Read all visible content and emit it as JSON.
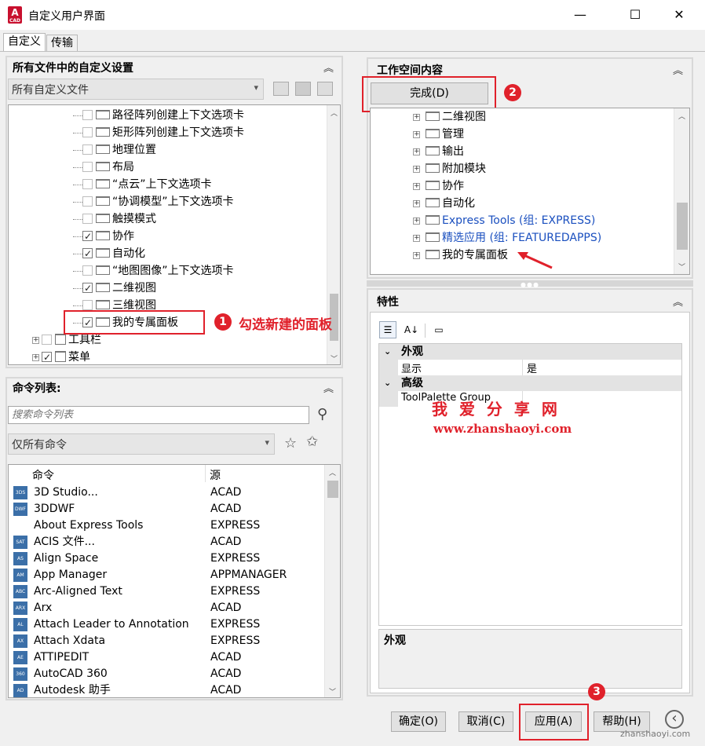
{
  "window": {
    "app_icon_letter": "A",
    "app_icon_sub": "CAD",
    "title": "自定义用户界面",
    "minimize": "—",
    "maximize": "☐",
    "close": "✕"
  },
  "tabs": [
    "自定义",
    "传输"
  ],
  "left_top": {
    "header": "所有文件中的自定义设置",
    "collapse": "︽",
    "file_select": "所有自定义文件",
    "tree": [
      {
        "label": "路径阵列创建上下文选项卡",
        "checked": false
      },
      {
        "label": "矩形阵列创建上下文选项卡",
        "checked": false
      },
      {
        "label": "地理位置",
        "checked": false
      },
      {
        "label": "布局",
        "checked": false
      },
      {
        "label": "“点云”上下文选项卡",
        "checked": false
      },
      {
        "label": "“协调模型”上下文选项卡",
        "checked": false
      },
      {
        "label": "触摸模式",
        "checked": false
      },
      {
        "label": "协作",
        "checked": true
      },
      {
        "label": "自动化",
        "checked": true
      },
      {
        "label": "“地图图像”上下文选项卡",
        "checked": false
      },
      {
        "label": "二维视图",
        "checked": true
      },
      {
        "label": "三维视图",
        "checked": false
      },
      {
        "label": "我的专属面板",
        "checked": true
      }
    ],
    "toolbars": "工具栏",
    "menus": "菜单"
  },
  "annotations": {
    "one": "1",
    "one_text": "勾选新建的面板",
    "two": "2",
    "three": "3",
    "watermark_cn": "我 爱 分 享 网",
    "watermark_url": "www.zhanshaoyi.com",
    "corner_url": "zhanshaoyi.com"
  },
  "cmd_list": {
    "header": "命令列表:",
    "collapse": "︽",
    "search_placeholder": "搜索命令列表",
    "filter": "仅所有命令",
    "col_command": "命令",
    "col_source": "源",
    "rows": [
      {
        "icon": "3DS",
        "name": "3D Studio...",
        "source": "ACAD"
      },
      {
        "icon": "DWF",
        "name": "3DDWF",
        "source": "ACAD"
      },
      {
        "icon": "",
        "name": "About Express Tools",
        "source": "EXPRESS"
      },
      {
        "icon": "SAT",
        "name": "ACIS 文件...",
        "source": "ACAD"
      },
      {
        "icon": "AS",
        "name": "Align Space",
        "source": "EXPRESS"
      },
      {
        "icon": "AM",
        "name": "App Manager",
        "source": "APPMANAGER"
      },
      {
        "icon": "ABC",
        "name": "Arc-Aligned Text",
        "source": "EXPRESS"
      },
      {
        "icon": "ARX",
        "name": "Arx",
        "source": "ACAD"
      },
      {
        "icon": "AL",
        "name": "Attach Leader to Annotation",
        "source": "EXPRESS"
      },
      {
        "icon": "AX",
        "name": "Attach Xdata",
        "source": "EXPRESS"
      },
      {
        "icon": "AE",
        "name": "ATTIPEDIT",
        "source": "ACAD"
      },
      {
        "icon": "360",
        "name": "AutoCAD 360",
        "source": "ACAD"
      },
      {
        "icon": "AD",
        "name": "Autodesk 助手",
        "source": "ACAD"
      }
    ]
  },
  "workspace": {
    "header": "工作空间内容",
    "collapse": "︽",
    "done_button": "完成(D)",
    "tree": [
      {
        "label": "二维视图",
        "blue": false
      },
      {
        "label": "管理",
        "blue": false
      },
      {
        "label": "输出",
        "blue": false
      },
      {
        "label": "附加模块",
        "blue": false
      },
      {
        "label": "协作",
        "blue": false
      },
      {
        "label": "自动化",
        "blue": false
      },
      {
        "label": "Express Tools (组: EXPRESS)",
        "blue": true
      },
      {
        "label": "精选应用 (组: FEATUREDAPPS)",
        "blue": true
      },
      {
        "label": "我的专属面板",
        "blue": false
      }
    ]
  },
  "properties": {
    "header": "特性",
    "collapse": "︽",
    "section_appearance": "外观",
    "display_label": "显示",
    "display_value": "是",
    "section_advanced": "高级",
    "toolpalette_label": "ToolPalette Group",
    "desc_title": "外观"
  },
  "footer": {
    "ok": "确定(O)",
    "cancel": "取消(C)",
    "apply": "应用(A)",
    "help": "帮助(H)",
    "back_icon": "‹"
  }
}
